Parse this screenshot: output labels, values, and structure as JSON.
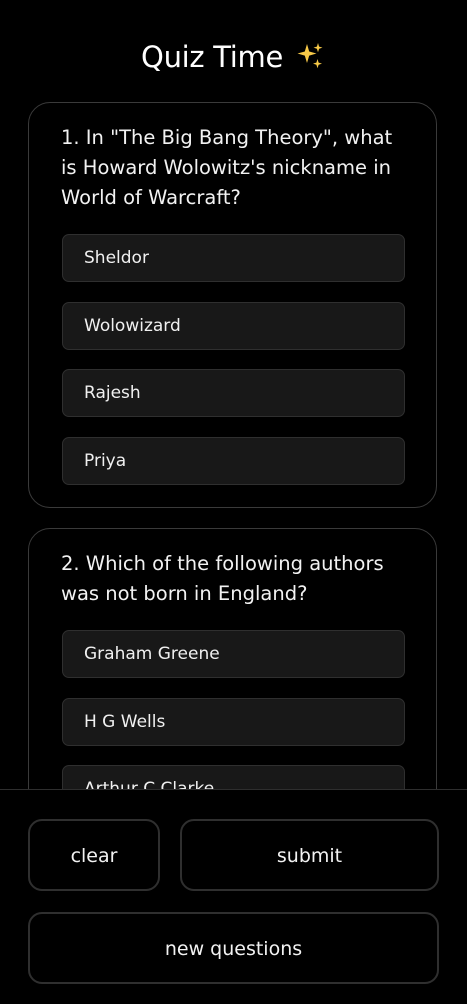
{
  "header": {
    "title": "Quiz Time",
    "icon": "sparkles-icon",
    "icon_color": "#f5c542"
  },
  "questions": [
    {
      "text": "1. In \"The Big Bang Theory\", what is Howard Wolowitz's nickname in World of Warcraft?",
      "options": [
        "Sheldor",
        "Wolowizard",
        "Rajesh",
        "Priya"
      ]
    },
    {
      "text": "2. Which of the following authors was not born in England?",
      "options": [
        "Graham Greene",
        "H G Wells",
        "Arthur C Clarke"
      ]
    }
  ],
  "actions": {
    "clear_label": "clear",
    "submit_label": "submit",
    "new_questions_label": "new questions"
  },
  "colors": {
    "background": "#000000",
    "option_background": "#181818",
    "border": "#2f2f2f",
    "text": "#ffffff"
  }
}
